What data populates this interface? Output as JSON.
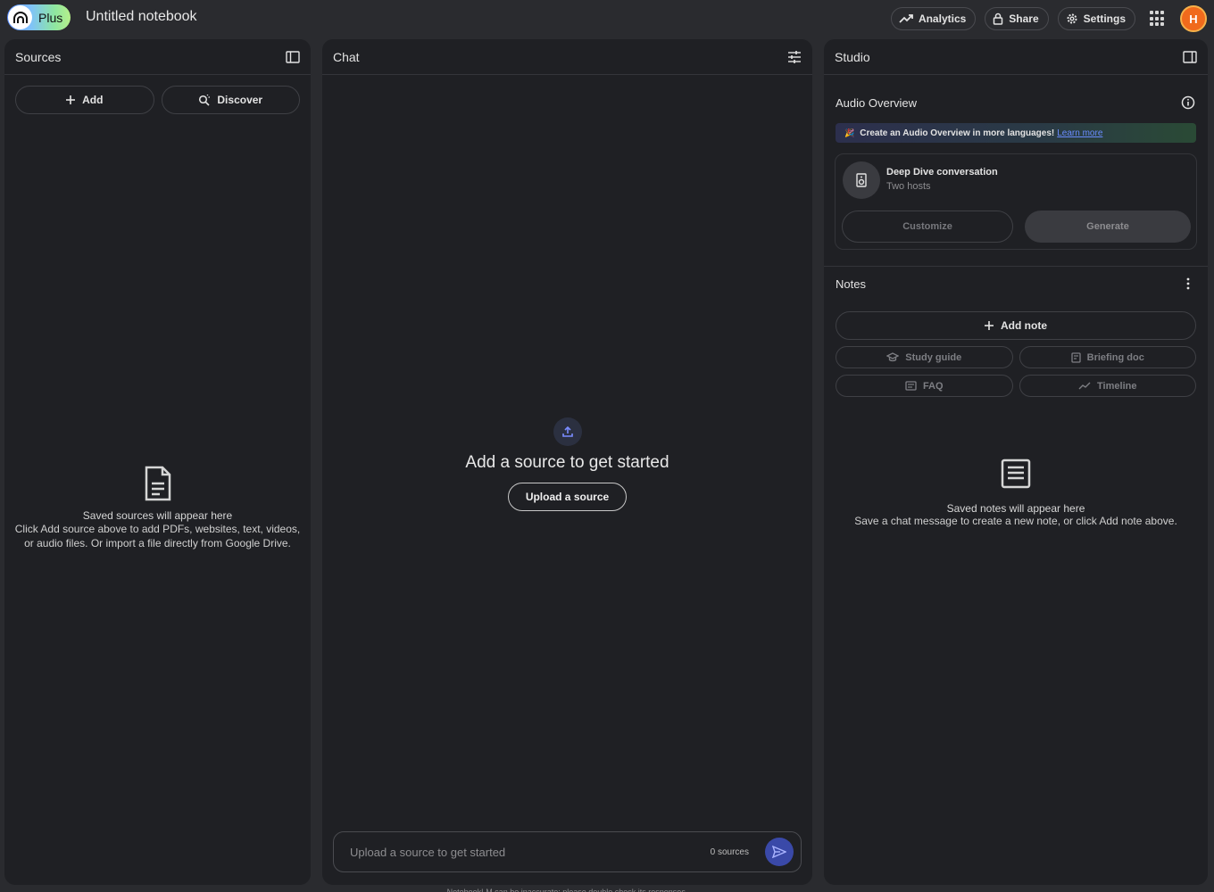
{
  "app": {
    "plan_badge": "Plus",
    "notebook_title": "Untitled notebook"
  },
  "topbar": {
    "analytics_label": "Analytics",
    "share_label": "Share",
    "settings_label": "Settings",
    "avatar_initial": "H"
  },
  "sources": {
    "title": "Sources",
    "add_label": "Add",
    "discover_label": "Discover",
    "empty_title": "Saved sources will appear here",
    "empty_line1": "Click Add source above to add PDFs, websites, text, videos,",
    "empty_line2": "or audio files. Or import a file directly from Google Drive."
  },
  "chat": {
    "title": "Chat",
    "empty_heading": "Add a source to get started",
    "upload_button": "Upload a source",
    "input_placeholder": "Upload a source to get started",
    "source_count": "0 sources",
    "footnote": "NotebookLM can be inaccurate; please double check its responses."
  },
  "studio": {
    "title": "Studio",
    "audio_overview": {
      "title": "Audio Overview",
      "banner_text": "Create an Audio Overview in more languages!",
      "banner_link": "Learn more",
      "card_title": "Deep Dive conversation",
      "card_subtitle": "Two hosts",
      "customize_label": "Customize",
      "generate_label": "Generate"
    },
    "notes": {
      "title": "Notes",
      "add_note_label": "Add note",
      "chips": [
        "Study guide",
        "Briefing doc",
        "FAQ",
        "Timeline"
      ],
      "empty_title": "Saved notes will appear here",
      "empty_text": "Save a chat message to create a new note, or click Add note above."
    }
  },
  "colors": {
    "background": "#2a2b2f",
    "panel": "#1f2024",
    "accent_send": "#3a49a8",
    "link": "#6a8cff",
    "avatar": "#f06a1c"
  }
}
